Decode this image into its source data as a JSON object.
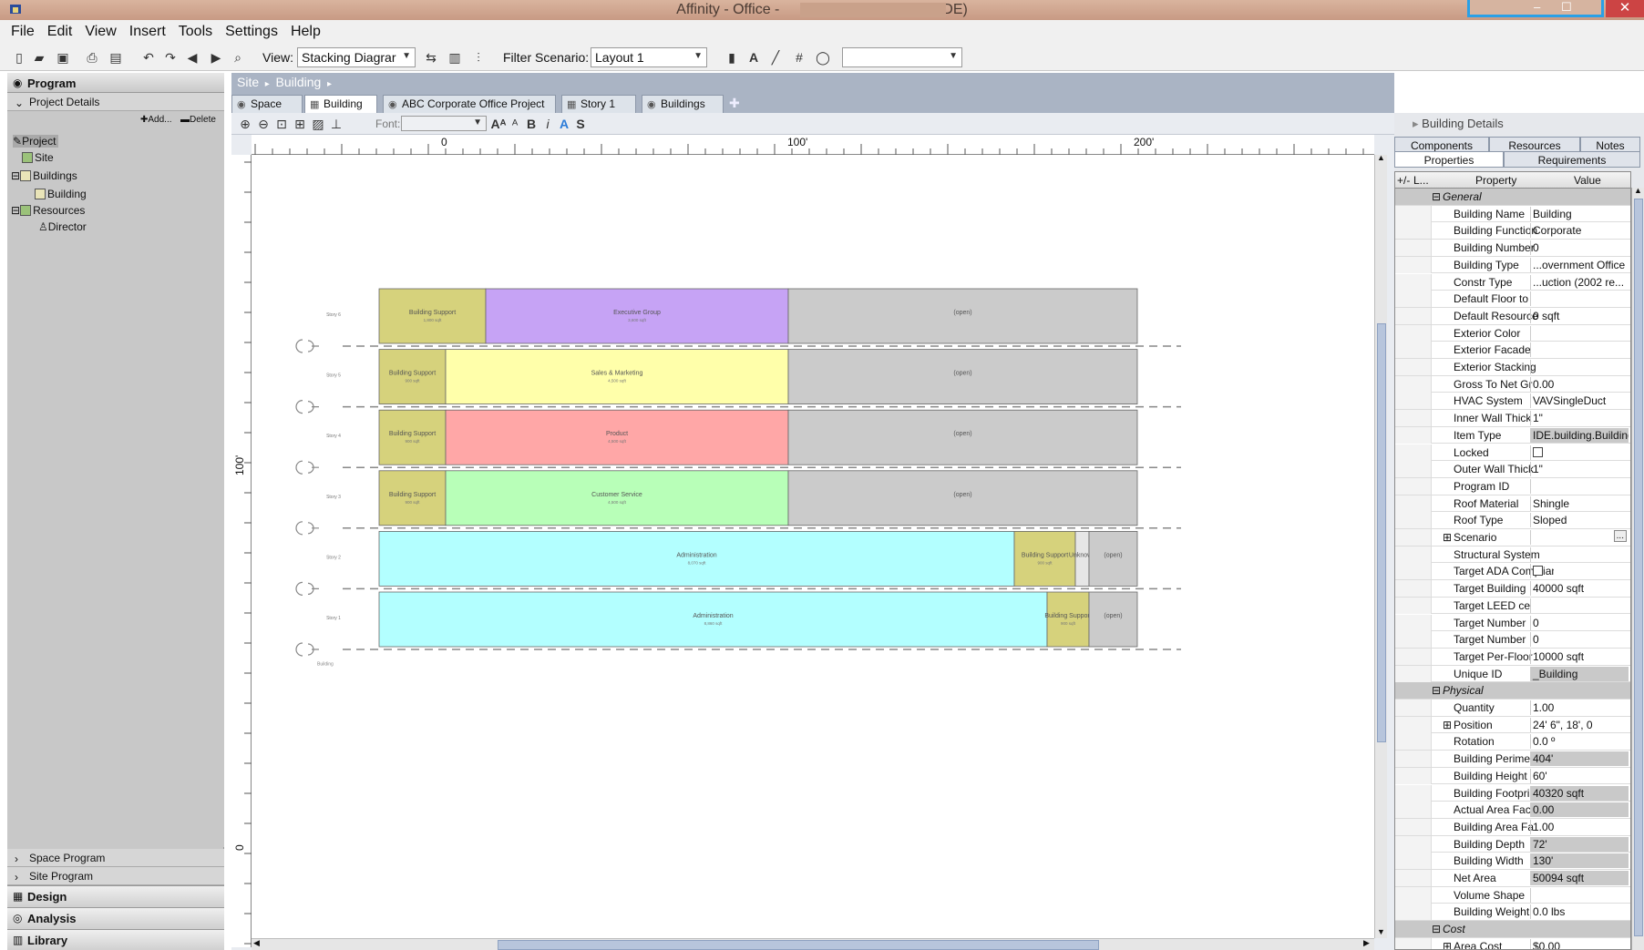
{
  "window": {
    "title_left": "Affinity - Office - ",
    "title_right": "IDE)",
    "close_glyph": "✕"
  },
  "menu": [
    "File",
    "Edit",
    "View",
    "Insert",
    "Tools",
    "Settings",
    "Help"
  ],
  "toolbar": {
    "view_label": "View:",
    "view_value": "Stacking Diagrar",
    "filter_label": "Filter Scenario:",
    "filter_value": "Layout 1",
    "extra_select_value": ""
  },
  "left_panel": {
    "program_header": "Program",
    "project_details": "Project Details",
    "add_label": "Add...",
    "delete_label": "Delete",
    "tree": [
      {
        "label": "Project",
        "depth": 0
      },
      {
        "label": "Site",
        "depth": 1
      },
      {
        "label": "Buildings",
        "depth": 0
      },
      {
        "label": "Building",
        "depth": 2
      },
      {
        "label": "Resources",
        "depth": 0
      },
      {
        "label": "Director",
        "depth": 2
      }
    ],
    "space_program": "Space Program",
    "site_program": "Site Program",
    "design": "Design",
    "analysis": "Analysis",
    "library": "Library"
  },
  "breadcrumb": [
    "Site",
    "Building"
  ],
  "doc_tabs": [
    "Space",
    "Building",
    "ABC Corporate Office Project",
    "Story 1",
    "Buildings"
  ],
  "format_bar": {
    "font_label": "Font:"
  },
  "ruler": {
    "top_labels": [
      "0",
      "100'",
      "200'"
    ],
    "left_labels": [
      "100'",
      "0"
    ]
  },
  "stack": {
    "building_label": "Building",
    "stories": [
      {
        "name": "Story 6",
        "blocks": [
          {
            "label": "Building Support",
            "sub": "1,800 sqft",
            "color": "#d6d27c",
            "w": 117
          },
          {
            "label": "Executive Group",
            "sub": "3,600 sqft",
            "color": "#c6a3f5",
            "w": 332
          },
          {
            "label": "(open)",
            "sub": "",
            "color": "#cbcbcb",
            "w": 383
          }
        ]
      },
      {
        "name": "Story 5",
        "blocks": [
          {
            "label": "Building Support",
            "sub": "900 sqft",
            "color": "#d6d27c",
            "w": 73
          },
          {
            "label": "Sales & Marketing",
            "sub": "4,500 sqft",
            "color": "#ffffaa",
            "w": 376
          },
          {
            "label": "(open)",
            "sub": "",
            "color": "#cbcbcb",
            "w": 383
          }
        ]
      },
      {
        "name": "Story 4",
        "blocks": [
          {
            "label": "Building Support",
            "sub": "900 sqft",
            "color": "#d6d27c",
            "w": 73
          },
          {
            "label": "Product",
            "sub": "4,500 sqft",
            "color": "#ffa7a7",
            "w": 376
          },
          {
            "label": "(open)",
            "sub": "",
            "color": "#cbcbcb",
            "w": 383
          }
        ]
      },
      {
        "name": "Story 3",
        "blocks": [
          {
            "label": "Building Support",
            "sub": "900 sqft",
            "color": "#d6d27c",
            "w": 73
          },
          {
            "label": "Customer Service",
            "sub": "4,500 sqft",
            "color": "#b8ffb8",
            "w": 376
          },
          {
            "label": "(open)",
            "sub": "",
            "color": "#cbcbcb",
            "w": 383
          }
        ]
      },
      {
        "name": "Story 2",
        "blocks": [
          {
            "label": "Administration",
            "sub": "8,070 sqft",
            "color": "#b3ffff",
            "w": 697
          },
          {
            "label": "Building Support",
            "sub": "900 sqft",
            "color": "#d6d27c",
            "w": 67
          },
          {
            "label": "Unknown",
            "sub": "",
            "color": "#e6e6e6",
            "w": 15
          },
          {
            "label": "(open)",
            "sub": "",
            "color": "#cbcbcb",
            "w": 53
          }
        ]
      },
      {
        "name": "Story 1",
        "blocks": [
          {
            "label": "Administration",
            "sub": "8,860 sqft",
            "color": "#b3ffff",
            "w": 733
          },
          {
            "label": "Building Support",
            "sub": "900 sqft",
            "color": "#d6d27c",
            "w": 46
          },
          {
            "label": "(open)",
            "sub": "",
            "color": "#cbcbcb",
            "w": 53
          }
        ]
      }
    ]
  },
  "right_panel": {
    "title": "Building Details",
    "tabs_row1": [
      "Components",
      "Resources",
      "Notes"
    ],
    "tabs_row2": [
      "Properties",
      "Requirements"
    ],
    "col_headers": [
      "+/-",
      "L...",
      "Property",
      "Value"
    ],
    "rows": [
      {
        "cat": "General"
      },
      {
        "name": "Building Name",
        "value": "Building"
      },
      {
        "name": "Building Function",
        "value": "Corporate"
      },
      {
        "name": "Building Number",
        "value": "0"
      },
      {
        "name": "Building Type",
        "value": "...overnment Office"
      },
      {
        "name": "Constr Type",
        "value": "...uction (2002 re..."
      },
      {
        "name": "Default Floor to",
        "value": ""
      },
      {
        "name": "Default Resource",
        "value": "0 sqft"
      },
      {
        "name": "Exterior Color",
        "value": ""
      },
      {
        "name": "Exterior Facade",
        "value": ""
      },
      {
        "name": "Exterior Stacking",
        "value": ""
      },
      {
        "name": "Gross To Net Gr",
        "value": "0.00"
      },
      {
        "name": "HVAC System",
        "value": "VAVSingleDuct"
      },
      {
        "name": "Inner Wall Thick",
        "value": "1\""
      },
      {
        "name": "Item Type",
        "value": "IDE.building.Building",
        "ro": true
      },
      {
        "name": "Locked",
        "value": "",
        "check": true
      },
      {
        "name": "Outer Wall Thick",
        "value": "1\""
      },
      {
        "name": "Program ID",
        "value": ""
      },
      {
        "name": "Roof Material",
        "value": "Shingle"
      },
      {
        "name": "Roof Type",
        "value": "Sloped"
      },
      {
        "name": "Scenario",
        "value": "",
        "expand": true,
        "ellipsis": "..."
      },
      {
        "name": "Structural System",
        "value": ""
      },
      {
        "name": "Target ADA Compliant",
        "value": "",
        "check": true
      },
      {
        "name": "Target Building",
        "value": "40000 sqft"
      },
      {
        "name": "Target LEED ce",
        "value": ""
      },
      {
        "name": "Target Number",
        "value": "0"
      },
      {
        "name": "Target Number",
        "value": "0"
      },
      {
        "name": "Target Per-Floor",
        "value": "10000 sqft"
      },
      {
        "name": "Unique ID",
        "value": "_Building",
        "ro": true
      },
      {
        "cat": "Physical"
      },
      {
        "name": "Quantity",
        "value": "1.00"
      },
      {
        "name": "Position",
        "value": "24' 6\", 18', 0",
        "expand": true
      },
      {
        "name": "Rotation",
        "value": "0.0 º"
      },
      {
        "name": "Building Perimeter",
        "value": "404'",
        "ro": true
      },
      {
        "name": "Building Height",
        "value": "60'"
      },
      {
        "name": "Building Footprint",
        "value": "40320 sqft",
        "ro": true
      },
      {
        "name": "Actual Area Factor",
        "value": "0.00",
        "ro": true
      },
      {
        "name": "Building Area Fa",
        "value": "1.00"
      },
      {
        "name": "Building Depth",
        "value": "72'",
        "ro": true
      },
      {
        "name": "Building Width",
        "value": "130'",
        "ro": true
      },
      {
        "name": "Net Area",
        "value": "50094 sqft",
        "ro": true
      },
      {
        "name": "Volume Shape",
        "value": ""
      },
      {
        "name": "Building Weight",
        "value": "0.0 lbs"
      },
      {
        "cat": "Cost"
      },
      {
        "name": "Area Cost",
        "value": "$0.00",
        "expand": true
      }
    ]
  }
}
